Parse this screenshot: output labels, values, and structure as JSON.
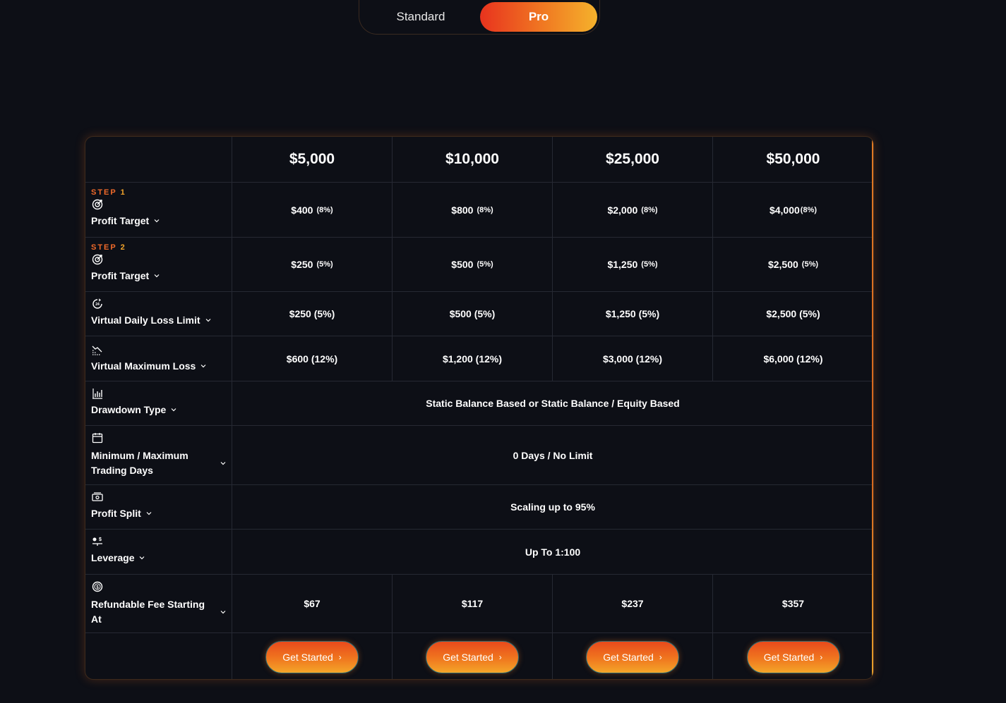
{
  "toggle": {
    "standard_label": "Standard",
    "pro_label": "Pro"
  },
  "columns": [
    "$5,000",
    "$10,000",
    "$25,000",
    "$50,000"
  ],
  "rows": {
    "step1": {
      "step_word": "STEP",
      "step_num": "1",
      "label": "Profit Target",
      "values": [
        {
          "main": "$400",
          "pct": "(8%)"
        },
        {
          "main": "$800",
          "pct": "(8%)"
        },
        {
          "main": "$2,000",
          "pct": "(8%)"
        },
        {
          "main": "$4,000",
          "pct": "(8%)"
        }
      ]
    },
    "step2": {
      "step_word": "STEP",
      "step_num": "2",
      "label": "Profit Target",
      "values": [
        {
          "main": "$250",
          "pct": "(5%)"
        },
        {
          "main": "$500",
          "pct": "(5%)"
        },
        {
          "main": "$1,250",
          "pct": "(5%)"
        },
        {
          "main": "$2,500",
          "pct": "(5%)"
        }
      ]
    },
    "daily_loss": {
      "label": "Virtual Daily Loss Limit",
      "values": [
        "$250 (5%)",
        "$500 (5%)",
        "$1,250 (5%)",
        "$2,500 (5%)"
      ]
    },
    "max_loss": {
      "label": "Virtual Maximum Loss",
      "values": [
        "$600 (12%)",
        "$1,200 (12%)",
        "$3,000 (12%)",
        "$6,000 (12%)"
      ]
    },
    "drawdown": {
      "label": "Drawdown Type",
      "value": "Static Balance Based or Static Balance / Equity Based"
    },
    "trading_days": {
      "label": "Minimum / Maximum Trading Days",
      "value": "0 Days / No Limit"
    },
    "profit_split": {
      "label": "Profit Split",
      "value": "Scaling up to 95%"
    },
    "leverage": {
      "label": "Leverage",
      "value": "Up To 1:100"
    },
    "fee": {
      "label": "Refundable Fee Starting At",
      "values": [
        "$67",
        "$117",
        "$237",
        "$357"
      ]
    }
  },
  "cta_label": "Get Started",
  "colors": {
    "accent_start": "#e8331e",
    "accent_end": "#f5b22c",
    "background": "#0d0f16"
  },
  "icons": [
    "target-icon",
    "clock-24-icon",
    "trend-down-icon",
    "bar-chart-icon",
    "calendar-icon",
    "money-icon",
    "leverage-icon",
    "coin-icon",
    "chevron-down-icon",
    "chevron-right-icon"
  ]
}
